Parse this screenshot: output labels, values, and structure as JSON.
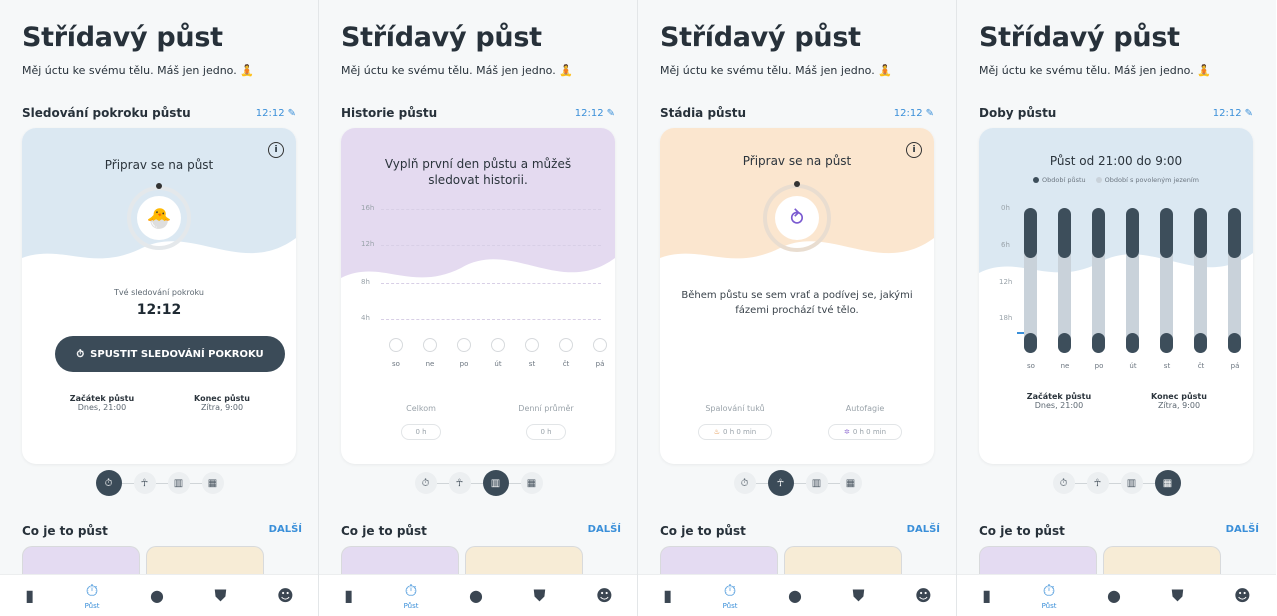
{
  "app": {
    "title": "Střídavý půst",
    "subtitle": "Měj úctu ke svému tělu. Máš jen jedno. 🧘"
  },
  "time_label": "12:12",
  "colors": {
    "accent": "#3a8fd9",
    "dark": "#3b4b58",
    "wave_blue": "#dbe8f2",
    "wave_purple": "#e4daf0",
    "wave_orange": "#fbe6cf"
  },
  "screens": [
    {
      "section_title": "Sledování pokroku půstu",
      "card": {
        "heading": "Připrav se na půst",
        "tracking_label": "Tvé sledování pokroku",
        "tracking_value": "12:12",
        "start_button": "SPUSTIT SLEDOVÁNÍ POKROKU",
        "start_label": "Začátek půstu",
        "start_value": "Dnes, 21:00",
        "end_label": "Konec půstu",
        "end_value": "Zítra, 9:00"
      }
    },
    {
      "section_title": "Historie půstu",
      "card": {
        "heading": "Vyplň první den půstu a můžeš sledovat historii.",
        "y_labels": [
          "16h",
          "12h",
          "8h",
          "4h"
        ],
        "days": [
          "so",
          "ne",
          "po",
          "út",
          "st",
          "čt",
          "pá"
        ],
        "total_label": "Celkom",
        "total_value": "0 h",
        "avg_label": "Denní průměr",
        "avg_value": "0 h"
      }
    },
    {
      "section_title": "Stádia půstu",
      "card": {
        "heading": "Připrav se na půst",
        "body": "Během půstu se sem vrať a podívej se, jakými fázemi prochází tvé tělo.",
        "fat_label": "Spalování tuků",
        "fat_value": "0 h 0 min",
        "auto_label": "Autofagie",
        "auto_value": "0 h 0 min"
      }
    },
    {
      "section_title": "Doby půstu",
      "card": {
        "heading": "Půst od 21:00 do 9:00",
        "legend_fast": "Období půstu",
        "legend_eat": "Období s povoleným jezením",
        "y_labels": [
          "0h",
          "6h",
          "12h",
          "18h"
        ],
        "days": [
          "so",
          "ne",
          "po",
          "út",
          "st",
          "čt",
          "pá"
        ],
        "start_label": "Začátek půstu",
        "start_value": "Dnes, 21:00",
        "end_label": "Konec půstu",
        "end_value": "Zítra, 9:00"
      }
    }
  ],
  "co_je_to_pust": "Co je to půst",
  "dalsi": "DALŠÍ",
  "nav": {
    "pust_label": "Půst",
    "icons": [
      "book-icon",
      "stopwatch-icon",
      "food-icon",
      "shield-icon",
      "profile-icon"
    ]
  }
}
